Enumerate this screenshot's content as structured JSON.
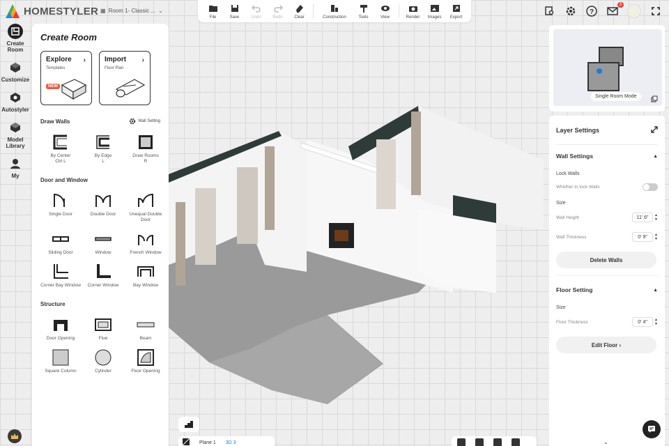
{
  "app": {
    "brand": "HOMESTYLER",
    "room_selector": "Room 1- Classic ...",
    "accent": "#1a7fd6"
  },
  "toolbar": {
    "items": [
      {
        "label": "File",
        "icon": "folder-icon",
        "disabled": false
      },
      {
        "label": "Save",
        "icon": "save-icon",
        "disabled": false
      },
      {
        "label": "Undo",
        "icon": "undo-icon",
        "disabled": true
      },
      {
        "label": "Redo",
        "icon": "redo-icon",
        "disabled": true
      },
      {
        "label": "Clear",
        "icon": "eraser-icon",
        "disabled": false
      },
      {
        "label": "Construction",
        "icon": "construction-icon",
        "disabled": false
      },
      {
        "label": "Tools",
        "icon": "tools-icon",
        "disabled": false
      },
      {
        "label": "View",
        "icon": "eye-icon",
        "disabled": false
      },
      {
        "label": "Render",
        "icon": "camera-icon",
        "disabled": false
      },
      {
        "label": "Images",
        "icon": "images-icon",
        "disabled": false
      },
      {
        "label": "Export",
        "icon": "export-icon",
        "disabled": false
      }
    ]
  },
  "top_right": {
    "notification_count": "3"
  },
  "rail": {
    "items": [
      {
        "label": "Create Room",
        "icon": "create-room-icon",
        "active": true
      },
      {
        "label": "Customize",
        "icon": "customize-icon",
        "active": false
      },
      {
        "label": "Autostyler",
        "icon": "autostyler-icon",
        "active": false
      },
      {
        "label": "Model Library",
        "icon": "model-library-icon",
        "active": false
      },
      {
        "label": "My",
        "icon": "user-icon",
        "active": false
      }
    ]
  },
  "left_panel": {
    "title": "Create Room",
    "explore": {
      "title": "Explore",
      "subtitle": "Templates",
      "badge": "NEW"
    },
    "import": {
      "title": "Import",
      "subtitle": "Floor Plan"
    },
    "draw_walls": {
      "heading": "Draw Walls",
      "wall_setting": "Wall Setting",
      "tools": [
        {
          "label": "By Center",
          "shortcut": "Ctrl L",
          "icon": "wall-by-center-icon"
        },
        {
          "label": "By Edge",
          "shortcut": "L",
          "icon": "wall-by-edge-icon"
        },
        {
          "label": "Draw Rooms",
          "shortcut": "R",
          "icon": "draw-rooms-icon"
        }
      ]
    },
    "door_window": {
      "heading": "Door and Window",
      "tools": [
        {
          "label": "Single Door",
          "icon": "single-door-icon"
        },
        {
          "label": "Double Door",
          "icon": "double-door-icon"
        },
        {
          "label": "Unequal Double Door",
          "icon": "unequal-double-door-icon"
        },
        {
          "label": "Sliding Door",
          "icon": "sliding-door-icon"
        },
        {
          "label": "Window",
          "icon": "window-icon"
        },
        {
          "label": "French Window",
          "icon": "french-window-icon"
        },
        {
          "label": "Corner Bay Window",
          "icon": "corner-bay-window-icon"
        },
        {
          "label": "Corner Window",
          "icon": "corner-window-icon"
        },
        {
          "label": "Bay Window",
          "icon": "bay-window-icon"
        }
      ]
    },
    "structure": {
      "heading": "Structure",
      "tools": [
        {
          "label": "Door Opening",
          "icon": "door-opening-icon"
        },
        {
          "label": "Flue",
          "icon": "flue-icon"
        },
        {
          "label": "Beam",
          "icon": "beam-icon"
        },
        {
          "label": "Square Column",
          "icon": "square-column-icon"
        },
        {
          "label": "Cylinder",
          "icon": "cylinder-icon"
        },
        {
          "label": "Floor Opening",
          "icon": "floor-opening-icon"
        }
      ]
    }
  },
  "minimap": {
    "mode_label": "Single Room Mode"
  },
  "right_panel": {
    "title": "Layer Settings",
    "wall_settings": {
      "heading": "Wall Settings",
      "lock_walls": "Lock Walls",
      "lock_question": "Whether to lock Walls",
      "lock_on": false,
      "size": "Size",
      "wall_height_label": "Wall Height",
      "wall_height": "11' 6\"",
      "wall_thickness_label": "Wall Thickness",
      "wall_thickness": "0' 9\"",
      "delete_button": "Delete Walls"
    },
    "floor_setting": {
      "heading": "Floor Setting",
      "size": "Size",
      "floor_thickness_label": "Floor Thickness",
      "floor_thickness": "0' 4\"",
      "edit_button": "Edit Floor ›"
    }
  },
  "view_switch": {
    "plane": "Plane",
    "plane_key": "1",
    "threed": "3D",
    "threed_key": "3",
    "active": "3D"
  }
}
